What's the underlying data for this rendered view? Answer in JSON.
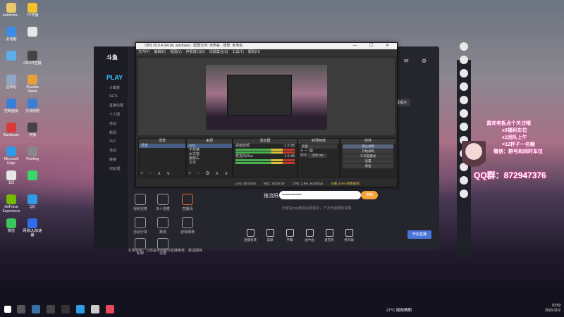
{
  "desktop": {
    "icons": [
      {
        "label": "Administr...",
        "color": "#e8c86a"
      },
      {
        "label": "YY开播",
        "color": "#f2c12e"
      },
      {
        "label": "此电脑",
        "color": "#3a8ee6"
      },
      {
        "label": "",
        "color": "#e6e6e6"
      },
      {
        "label": "",
        "color": "#5ab0e6"
      },
      {
        "label": "OBS开直播",
        "color": "#444444"
      },
      {
        "label": "回收站",
        "color": "#8fa8c8"
      },
      {
        "label": "Rosetta Stone",
        "color": "#e6a03a"
      },
      {
        "label": "控制面板",
        "color": "#3a7fd6"
      },
      {
        "label": "无线网络",
        "color": "#3a7fd6"
      },
      {
        "label": "Bandicam",
        "color": "#d63a3a"
      },
      {
        "label": "开播",
        "color": "#444444"
      },
      {
        "label": "Microsoft Edge",
        "color": "#2f9be6"
      },
      {
        "label": "Pixelmg",
        "color": "#888888"
      },
      {
        "label": "123",
        "color": "#e6e6e6"
      },
      {
        "label": "",
        "color": "#3ad66a"
      },
      {
        "label": "GeForce Experience",
        "color": "#76b900"
      },
      {
        "label": "QQ",
        "color": "#2f9be6"
      },
      {
        "label": "微信",
        "color": "#3ac65a"
      },
      {
        "label": "网易UU加速器",
        "color": "#2f6be6"
      }
    ]
  },
  "live_app": {
    "brand": "斗鱼",
    "play_tab": "PLAY",
    "side_items": [
      "大模板",
      "SETL",
      "直播设置",
      "十人团",
      "自动",
      "新闻",
      "2V2",
      "活动",
      "链接",
      "00处理"
    ],
    "status_text": "温馨提示",
    "stream_code_label": "推流码",
    "stream_code_value": "••••••••••••••••",
    "copy_button": "复制",
    "obs_hint": "天使在hop推送会更稳定，下次无需重新复制",
    "quick_items": [
      "视频连麦",
      "多人连麦",
      "直播场",
      "活动分享",
      "推流",
      "游戏推荐",
      "私聊",
      "设置"
    ],
    "feedback_text": "礼物任务，已经是手动操作直播推荐，敬请期待",
    "bottom_tools": [
      "直播背景",
      "美颜",
      "字幕",
      "画中画",
      "麦克风",
      "扬声器"
    ],
    "start_button": "开始直播",
    "qq_text": "QQ群：872947376",
    "overlay_lines": [
      "喜欢老板点个关注哦",
      "x6福利车位",
      "x1团队上午",
      "×12杯子一名额",
      "微信：群号和同时车位"
    ]
  },
  "obs": {
    "title": "OBS 25.0.4 (64 bit, windows) - 配置文件: 未命名 - 场景: 未命名",
    "menu": [
      "文件(F)",
      "编辑(E)",
      "视图(V)",
      "停靠窗口(D)",
      "场景集合(S)",
      "工具(T)",
      "帮助(H)"
    ],
    "docks": {
      "scenes": {
        "title": "场景",
        "items": [
          "场景"
        ]
      },
      "sources": {
        "title": "来源",
        "items": [
          "ypw",
          "不规律",
          "水文窗",
          "摄像头",
          "文字"
        ]
      },
      "mixer": {
        "title": "混音器",
        "tracks": [
          {
            "name": "桌面音频",
            "db": "-1.6 dB"
          },
          {
            "name": "麦克风/Aux",
            "db": "-1.6 dB"
          }
        ]
      },
      "transitions": {
        "title": "转场特效",
        "type": "淡出",
        "duration_label": "时长",
        "duration": "300 ms"
      },
      "controls": {
        "title": "控件",
        "buttons": [
          "停止录制",
          "开始录制",
          "工作室模式",
          "设置",
          "退出"
        ]
      }
    },
    "status": {
      "live": "LIVE: 00:00:00",
      "rec": "REC: 00:00:00",
      "cpu": "CPU: 2.8%, 60.00 fps",
      "warning": "过载 (54% 帧数据率)"
    }
  },
  "taskbar": {
    "weather": "27°C 局部晴朗",
    "time": "10:59",
    "date": "2021/11/2"
  }
}
